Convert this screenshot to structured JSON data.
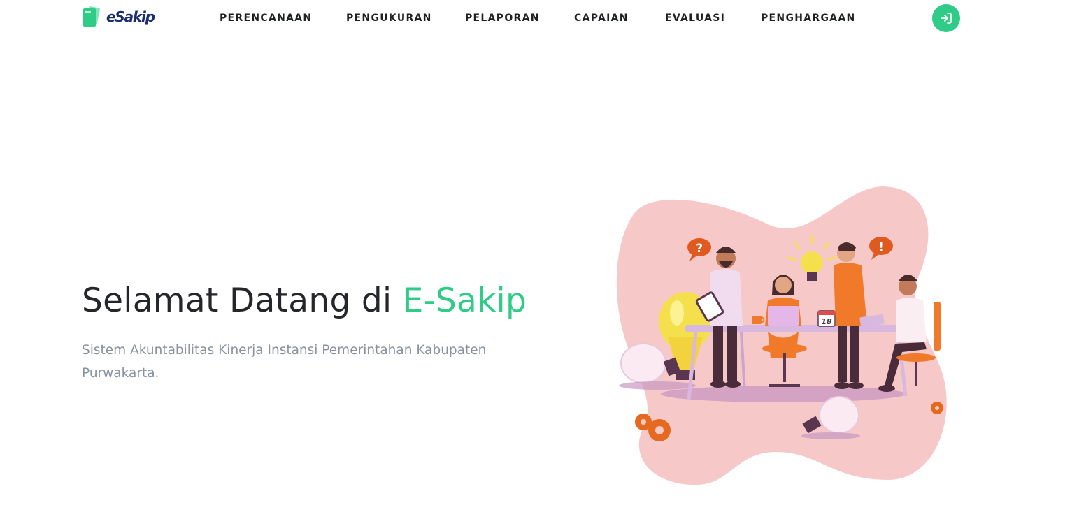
{
  "brand": {
    "logo_text": "eSakip",
    "accent_color": "#2ecc87",
    "text_color": "#1a2d6e"
  },
  "nav": {
    "items": [
      {
        "label": "PERENCANAAN"
      },
      {
        "label": "PENGUKURAN"
      },
      {
        "label": "PELAPORAN"
      },
      {
        "label": "CAPAIAN"
      },
      {
        "label": "EVALUASI"
      },
      {
        "label": "PENGHARGAAN"
      }
    ],
    "login_icon": "login-icon"
  },
  "hero": {
    "title_prefix": "Selamat Datang di ",
    "title_accent": "E-Sakip",
    "subtitle": "Sistem Akuntabilitas Kinerja Instansi Pemerintahan Kabupaten Purwakarta."
  },
  "illustration": {
    "blob_color": "#f6c8c8",
    "calendar_text": "18",
    "question_mark": "?",
    "exclamation_mark": "!"
  }
}
